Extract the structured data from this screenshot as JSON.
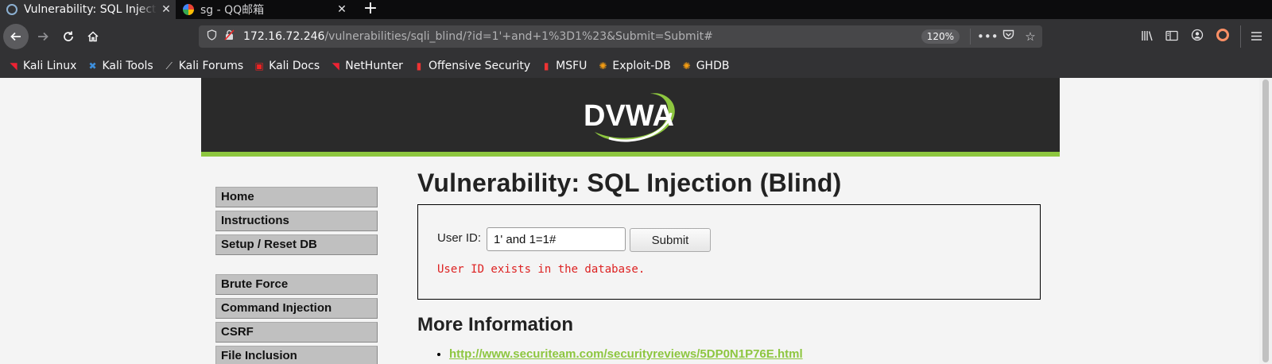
{
  "browser": {
    "tabs": [
      {
        "title": "Vulnerability: SQL Injecti",
        "active": true
      },
      {
        "title": "sg - QQ邮箱",
        "active": false
      }
    ],
    "new_tab_icon": "plus-icon",
    "url_host": "172.16.72.246",
    "url_path": "/vulnerabilities/sqli_blind/?id=1'+and+1%3D1%23&Submit=Submit#",
    "zoom": "120%",
    "bookmarks": [
      {
        "label": "Kali Linux",
        "icon": "kali-icon"
      },
      {
        "label": "Kali Tools",
        "icon": "kali-tools-icon"
      },
      {
        "label": "Kali Forums",
        "icon": "kali-forums-icon"
      },
      {
        "label": "Kali Docs",
        "icon": "kali-docs-icon"
      },
      {
        "label": "NetHunter",
        "icon": "nethunter-icon"
      },
      {
        "label": "Offensive Security",
        "icon": "offsec-icon"
      },
      {
        "label": "MSFU",
        "icon": "msfu-icon"
      },
      {
        "label": "Exploit-DB",
        "icon": "exploit-db-icon"
      },
      {
        "label": "GHDB",
        "icon": "ghdb-icon"
      }
    ]
  },
  "dvwa": {
    "logo_text": "DVWA",
    "menu": {
      "group1": [
        "Home",
        "Instructions",
        "Setup / Reset DB"
      ],
      "group2": [
        "Brute Force",
        "Command Injection",
        "CSRF",
        "File Inclusion"
      ]
    },
    "page_title": "Vulnerability: SQL Injection (Blind)",
    "form": {
      "user_id_label": "User ID:",
      "user_id_value": "1' and 1=1#",
      "submit_label": "Submit"
    },
    "result_text": "User ID exists in the database.",
    "more_info_title": "More Information",
    "more_info_links": [
      "http://www.securiteam.com/securityreviews/5DP0N1P76E.html"
    ]
  },
  "colors": {
    "accent": "#8dc63f",
    "error": "#dd2222",
    "header_bg": "#2a2a2a"
  }
}
